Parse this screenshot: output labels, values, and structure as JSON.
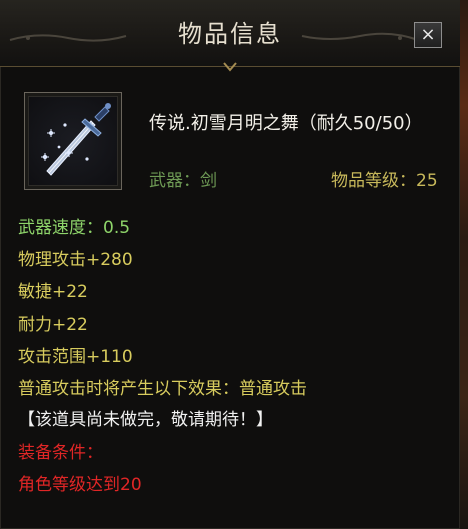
{
  "window": {
    "title": "物品信息",
    "close_label": "×"
  },
  "item": {
    "icon": "sword-icon",
    "name": "传说.初雪月明之舞（耐久50/50）",
    "type_text": "武器：剑",
    "level_text": "物品等级：25"
  },
  "stats": [
    {
      "text": "武器速度：0.5",
      "color": "#8ed46a"
    },
    {
      "text": "物理攻击+280",
      "color": "#d8cc5e"
    },
    {
      "text": "敏捷+22",
      "color": "#d8cc5e"
    },
    {
      "text": "耐力+22",
      "color": "#d8cc5e"
    },
    {
      "text": "攻击范围+110",
      "color": "#d8cc5e"
    },
    {
      "text": "普通攻击时将产生以下效果：普通攻击",
      "color": "#d8cc5e"
    },
    {
      "text": "【该道具尚未做完，敬请期待！】",
      "color": "#f1f1f1"
    },
    {
      "text": "装备条件：",
      "color": "#e02626"
    },
    {
      "text": "角色等级达到20",
      "color": "#e02626"
    }
  ],
  "colors": {
    "title": "#e6dfcf",
    "item_name": "#f2efe8",
    "type": "#6e9a55",
    "level": "#c8b95b"
  }
}
